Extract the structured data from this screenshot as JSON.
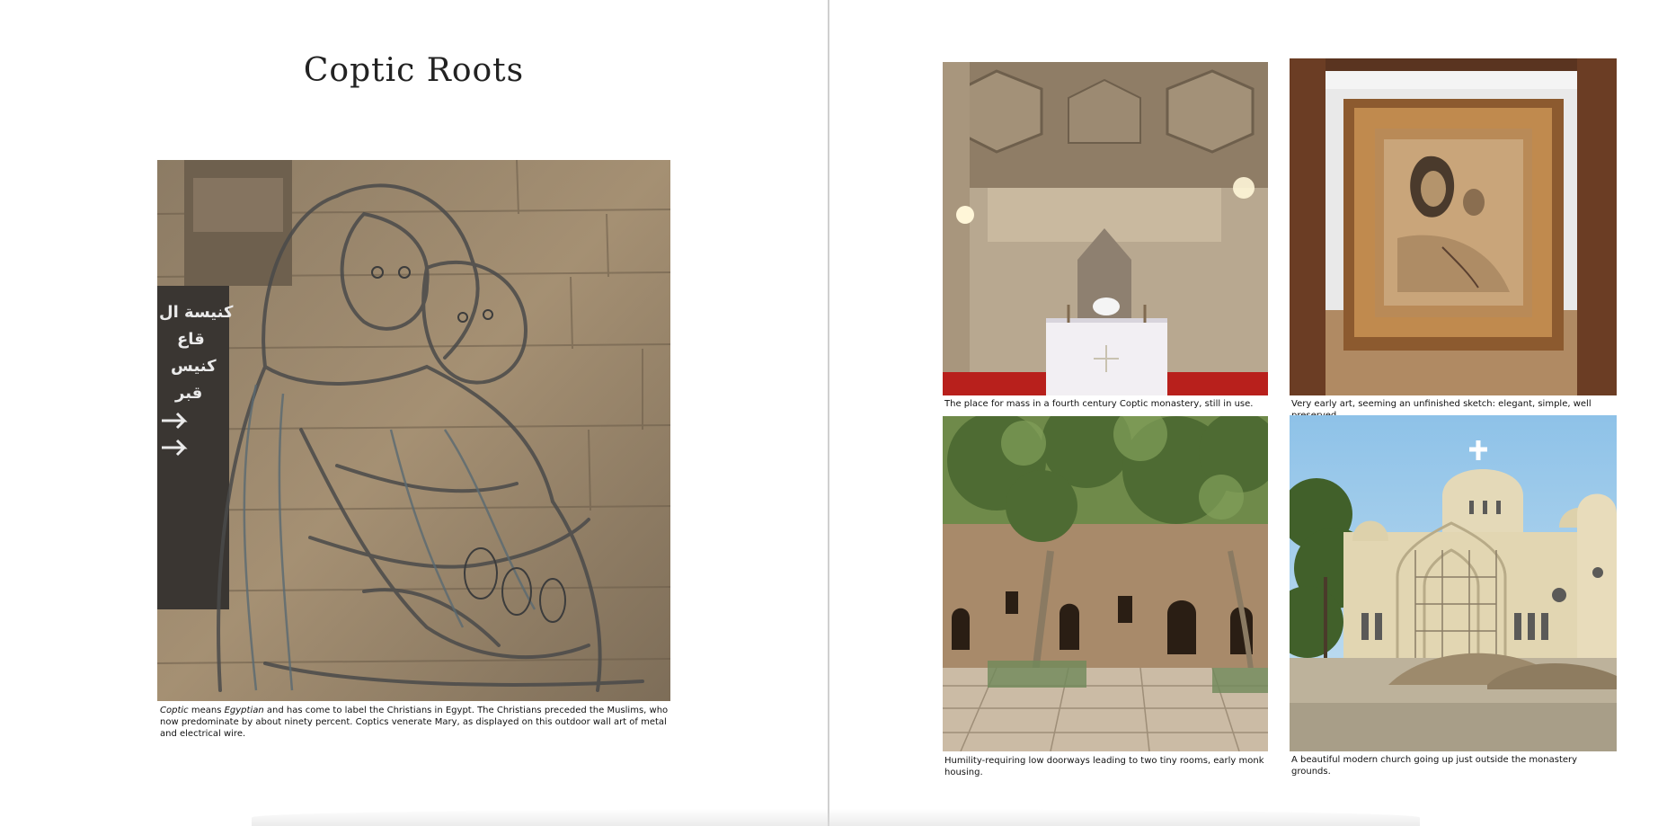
{
  "left_page": {
    "title": "Coptic Roots",
    "main_caption": {
      "italic_word_1": "Coptic",
      "part_1": " means ",
      "italic_word_2": "Egyptian",
      "part_2": " and has come to label the Christians in Egypt. The Christians preceded the Muslims, who now predominate by about ninety percent. Coptics venerate Mary, as displayed on this outdoor wall art of metal and electrical wire."
    },
    "sign_text": [
      "كنيسة ال",
      "قاع",
      "كنيس",
      "قبر"
    ]
  },
  "right_page": {
    "photos": [
      {
        "caption": "The place for mass in a fourth century Coptic monastery, still in use."
      },
      {
        "caption": "Very early art, seeming an unfinished sketch: elegant, simple, well preserved."
      },
      {
        "caption": "Humility-requiring low doorways leading to two tiny rooms, early monk housing."
      },
      {
        "caption": "A beautiful modern church going up just outside the monastery grounds."
      }
    ]
  },
  "colors": {
    "page_background": "#ffffff",
    "gutter": "#cfcfcf",
    "text": "#111111"
  }
}
